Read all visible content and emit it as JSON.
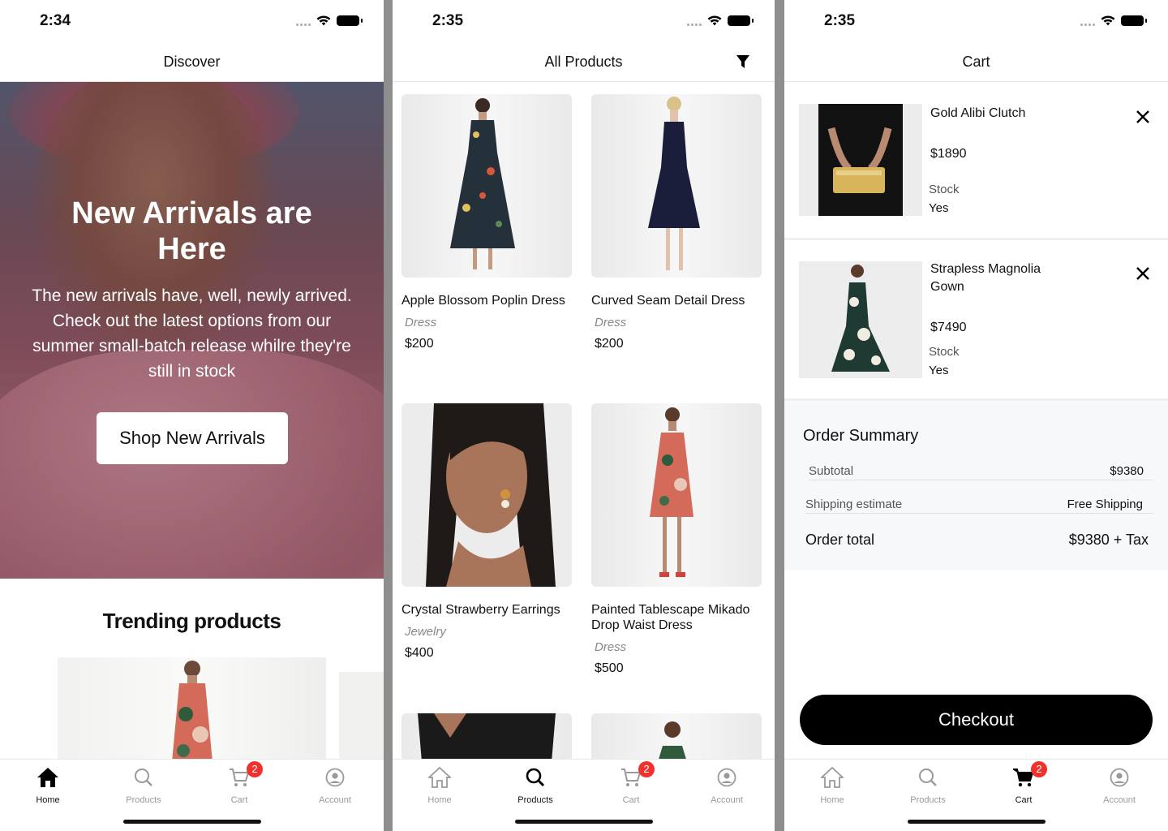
{
  "screens": {
    "discover": {
      "time": "2:34",
      "title": "Discover",
      "hero": {
        "heading": "New Arrivals are Here",
        "body": "The new arrivals have, well, newly arrived. Check out the latest options from our summer small-batch release whilre they're still in stock",
        "cta": "Shop New Arrivals"
      },
      "trending_title": "Trending products"
    },
    "products": {
      "time": "2:35",
      "title": "All Products",
      "items": [
        {
          "name": "Apple Blossom Poplin Dress",
          "category": "Dress",
          "price": "$200"
        },
        {
          "name": "Curved Seam Detail Dress",
          "category": "Dress",
          "price": "$200"
        },
        {
          "name": "Crystal Strawberry Earrings",
          "category": "Jewelry",
          "price": "$400"
        },
        {
          "name": "Painted Tablescape Mikado Drop Waist Dress",
          "category": "Dress",
          "price": "$500"
        }
      ]
    },
    "cart": {
      "time": "2:35",
      "title": "Cart",
      "items": [
        {
          "name": "Gold Alibi Clutch",
          "price": "$1890",
          "stock_label": "Stock",
          "stock_value": "Yes"
        },
        {
          "name": "Strapless Magnolia Gown",
          "price": "$7490",
          "stock_label": "Stock",
          "stock_value": "Yes"
        }
      ],
      "summary": {
        "title": "Order Summary",
        "subtotal_label": "Subtotal",
        "subtotal_value": "$9380",
        "shipping_label": "Shipping estimate",
        "shipping_value": "Free Shipping",
        "total_label": "Order total",
        "total_value": "$9380 + Tax"
      },
      "checkout": "Checkout"
    }
  },
  "tabs": {
    "home": "Home",
    "products": "Products",
    "cart": "Cart",
    "account": "Account",
    "cart_badge": "2"
  },
  "colors": {
    "badge": "#f0312c",
    "checkout_bg": "#000000",
    "summary_bg": "#f7f8fa"
  }
}
